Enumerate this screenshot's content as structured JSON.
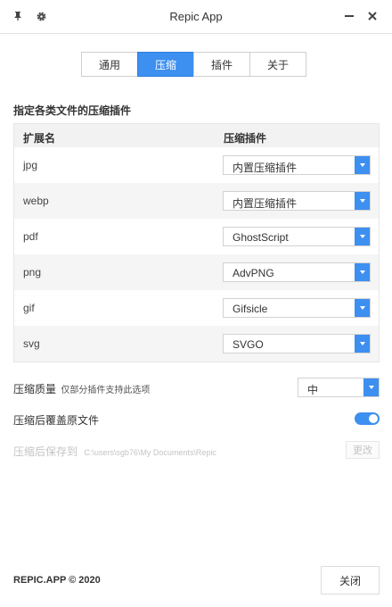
{
  "window": {
    "title": "Repic App"
  },
  "tabs": [
    {
      "label": "通用"
    },
    {
      "label": "压缩"
    },
    {
      "label": "插件"
    },
    {
      "label": "关于"
    }
  ],
  "section": {
    "title": "指定各类文件的压缩插件"
  },
  "table": {
    "headers": [
      "扩展名",
      "压缩插件"
    ],
    "rows": [
      {
        "ext": "jpg",
        "plugin": "内置压缩插件"
      },
      {
        "ext": "webp",
        "plugin": "内置压缩插件"
      },
      {
        "ext": "pdf",
        "plugin": "GhostScript"
      },
      {
        "ext": "png",
        "plugin": "AdvPNG"
      },
      {
        "ext": "gif",
        "plugin": "Gifsicle"
      },
      {
        "ext": "svg",
        "plugin": "SVGO"
      }
    ]
  },
  "options": {
    "quality_label": "压缩质量",
    "quality_hint": "仅部分插件支持此选项",
    "quality_value": "中",
    "overwrite_label": "压缩后覆盖原文件",
    "overwrite_on": true,
    "save_label": "压缩后保存到",
    "save_path": "C:\\users\\sgb76\\My Documents\\Repic",
    "change_label": "更改"
  },
  "footer": {
    "brand": "REPIC.APP © 2020",
    "close_label": "关闭"
  },
  "colors": {
    "accent": "#3d8ff0"
  }
}
